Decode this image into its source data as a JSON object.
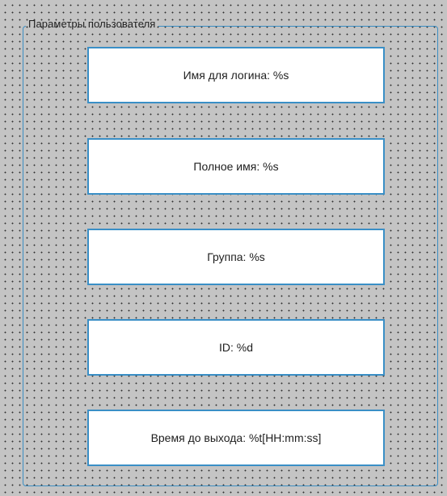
{
  "group": {
    "title": "Параметры пользователя"
  },
  "fields": [
    {
      "label": "Имя для логина: %s"
    },
    {
      "label": "Полное имя: %s"
    },
    {
      "label": "Группа: %s"
    },
    {
      "label": "ID: %d"
    },
    {
      "label": "Время до выхода: %t[HH:mm:ss]"
    }
  ]
}
